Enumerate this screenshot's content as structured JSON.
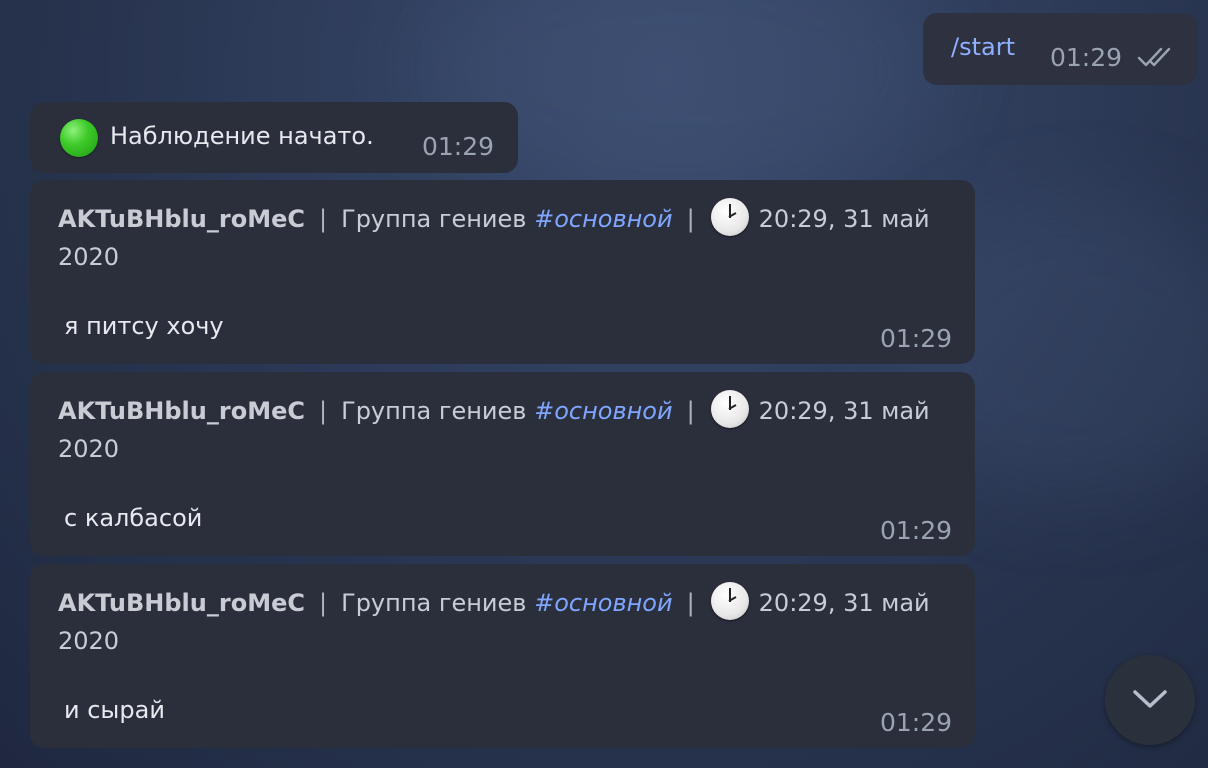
{
  "outgoing": {
    "command": "/start",
    "time": "01:29",
    "status_icon": "double-check-icon"
  },
  "status_message": {
    "icon": "green-circle",
    "text": "Наблюдение начато.",
    "time": "01:29"
  },
  "messages": [
    {
      "author": "AKTuBHblu_roMeC",
      "separator": "|",
      "group": "Группа гениев",
      "hashtag": "#основной",
      "datetime": "20:29, 31 май 2020",
      "text": "я питсу хочу",
      "time": "01:29"
    },
    {
      "author": "AKTuBHblu_roMeC",
      "separator": "|",
      "group": "Группа гениев",
      "hashtag": "#основной",
      "datetime": "20:29, 31 май 2020",
      "text": "с калбасой",
      "time": "01:29"
    },
    {
      "author": "AKTuBHblu_roMeC",
      "separator": "|",
      "group": "Группа гениев",
      "hashtag": "#основной",
      "datetime": "20:29, 31 май 2020",
      "text": "и сырай",
      "time": "01:29"
    }
  ],
  "scroll_button": {
    "icon": "chevron-down-icon"
  }
}
